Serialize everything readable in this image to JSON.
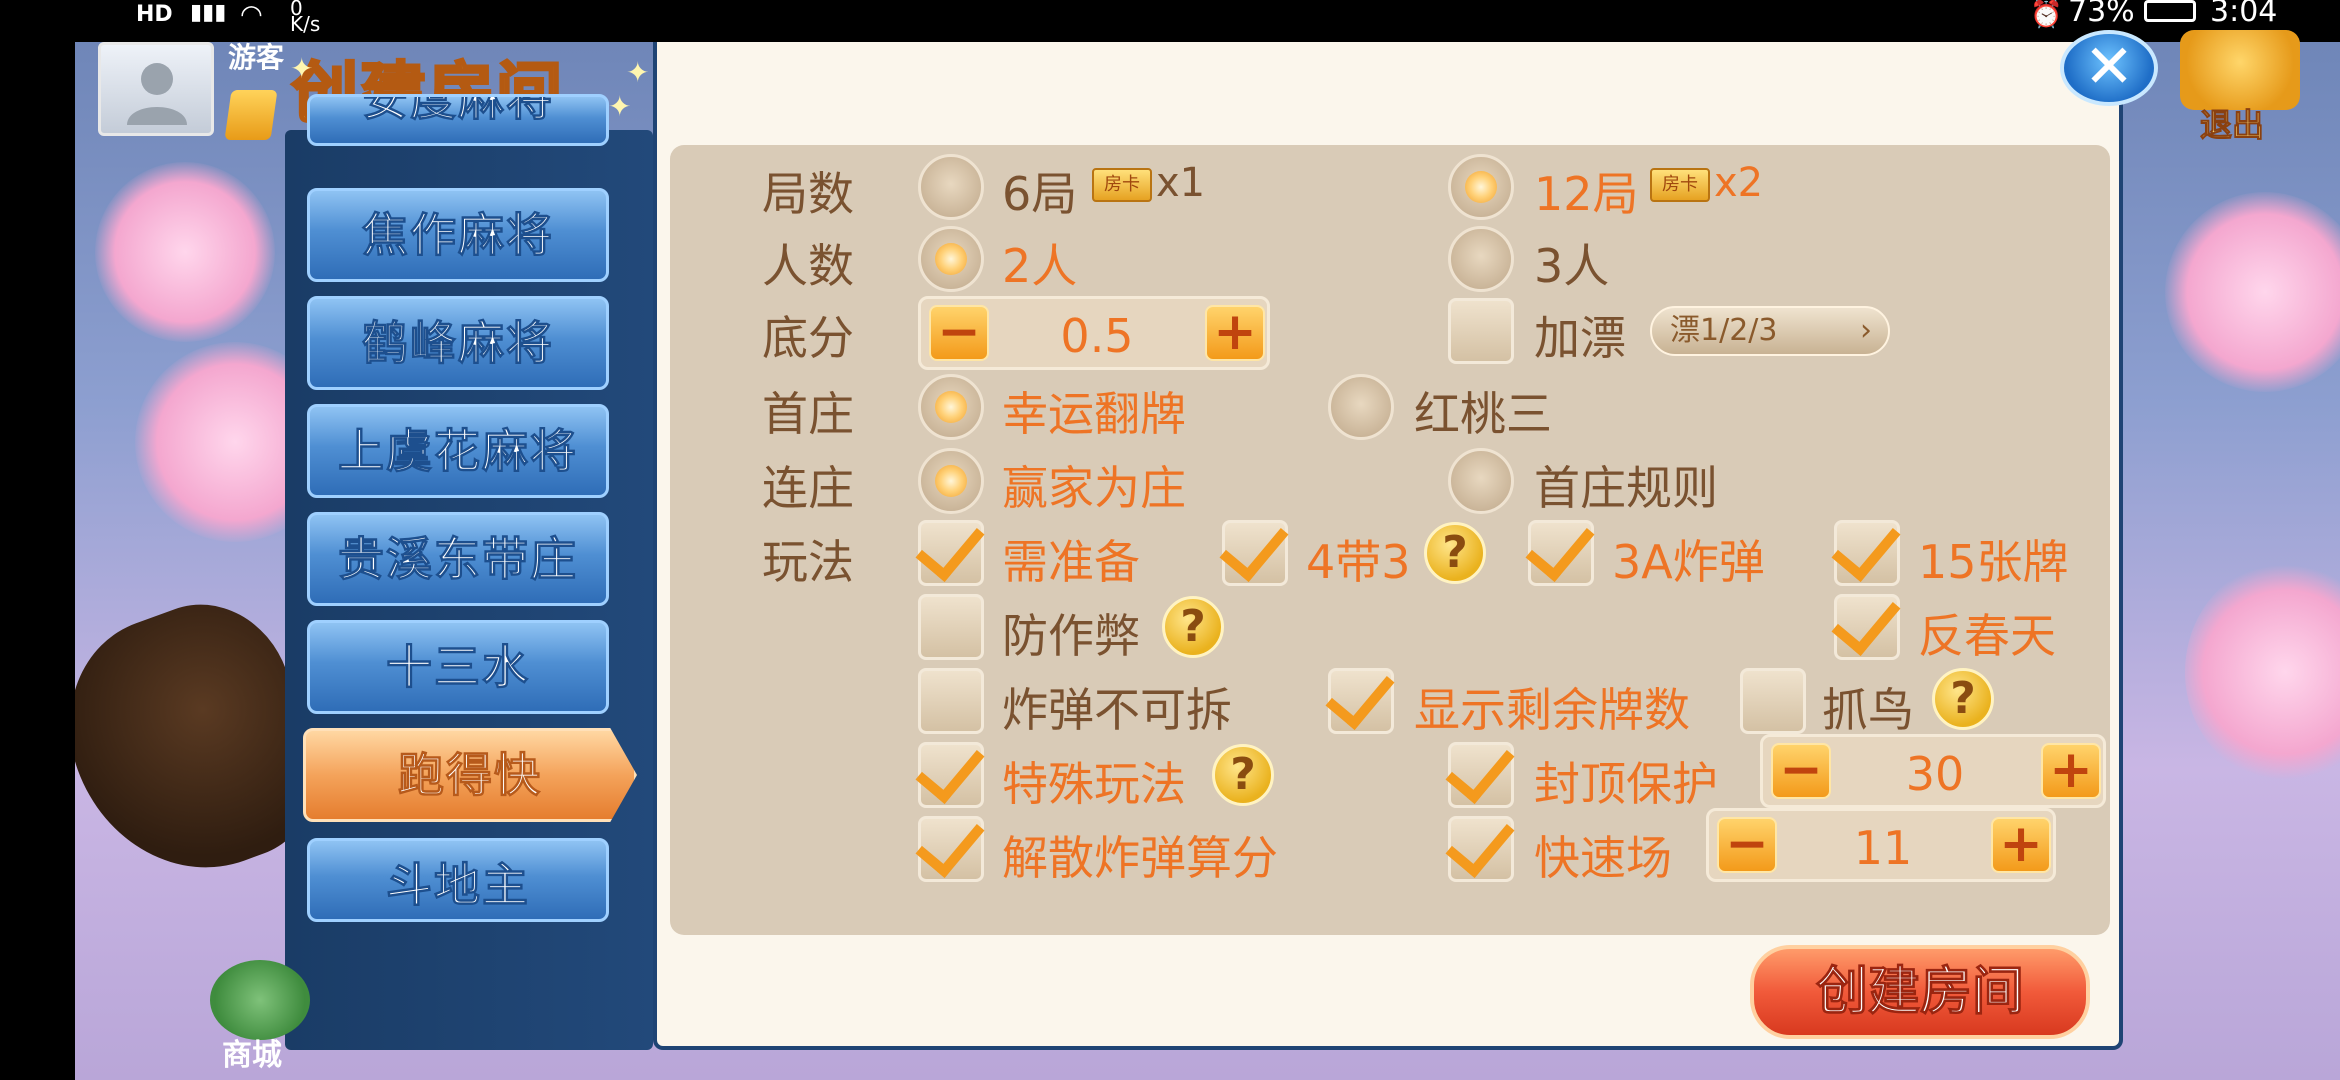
{
  "status_bar": {
    "left_icons": "HD",
    "net_speed_value": "0",
    "net_speed_unit": "K/s",
    "battery": "73%",
    "time": "3:04"
  },
  "header": {
    "guest_label": "游客",
    "title": "创建房间"
  },
  "sidebar": {
    "items": [
      {
        "label": "安度麻将"
      },
      {
        "label": "焦作麻将"
      },
      {
        "label": "鹤峰麻将"
      },
      {
        "label": "上虞花麻将"
      },
      {
        "label": "贵溪东带庄"
      },
      {
        "label": "十三水"
      },
      {
        "label": "跑得快"
      },
      {
        "label": "斗地主"
      }
    ],
    "active_index": 6
  },
  "form": {
    "rounds": {
      "label": "局数",
      "opt1": "6局",
      "opt1_mult": "x1",
      "opt2": "12局",
      "opt2_mult": "x2",
      "card_label": "房卡"
    },
    "players": {
      "label": "人数",
      "opt1": "2人",
      "opt2": "3人"
    },
    "base": {
      "label": "底分",
      "value": "0.5",
      "float_label": "加漂",
      "float_select": "漂1/2/3"
    },
    "first_dealer": {
      "label": "首庄",
      "opt1": "幸运翻牌",
      "opt2": "红桃三"
    },
    "continue_dealer": {
      "label": "连庄",
      "opt1": "赢家为庄",
      "opt2": "首庄规则"
    },
    "play": {
      "label": "玩法",
      "need_ready": "需准备",
      "four_three": "4带3",
      "triple_a_bomb": "3A炸弹",
      "fifteen_cards": "15张牌",
      "anti_cheat": "防作弊",
      "reverse_spring": "反春天",
      "bomb_unsplit": "炸弹不可拆",
      "show_remaining": "显示剩余牌数",
      "catch_bird": "抓鸟",
      "special_play": "特殊玩法",
      "cap_protect": "封顶保护",
      "cap_value": "30",
      "dismiss_bomb": "解散炸弹算分",
      "fast_mode": "快速场",
      "fast_value": "11"
    },
    "help_symbol": "?",
    "minus": "−",
    "plus": "+"
  },
  "create_button": "创建房间",
  "close_symbol": "✕",
  "exit_label": "退出",
  "shop_label": "商城",
  "colors": {
    "accent": "#ee7425",
    "label": "#7a5230",
    "panel": "#d9cbb7"
  }
}
